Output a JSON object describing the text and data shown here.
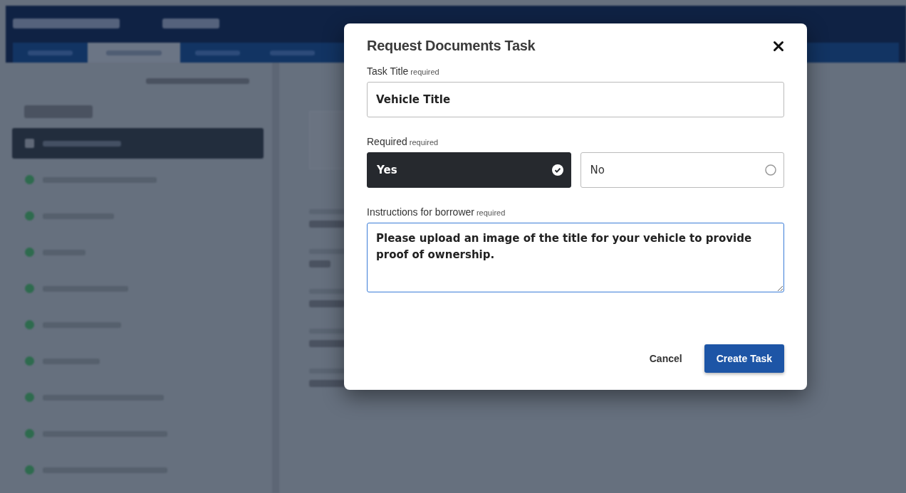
{
  "dialog": {
    "title": "Request Documents Task",
    "fields": [
      {
        "kind": "text",
        "label": "Task Title",
        "hint": "required",
        "value": "Vehicle Title"
      },
      {
        "kind": "choice",
        "label": "Required",
        "hint": "required",
        "options": [
          {
            "label": "Yes",
            "selected": true
          },
          {
            "label": "No",
            "selected": false
          }
        ]
      },
      {
        "kind": "textarea",
        "label": "Instructions for borrower",
        "hint": "required",
        "value": "Please upload an image of the title for your vehicle to provide proof of ownership."
      }
    ],
    "buttons": [
      {
        "label": "Cancel",
        "kind": "secondary"
      },
      {
        "label": "Create Task",
        "kind": "primary"
      }
    ]
  }
}
